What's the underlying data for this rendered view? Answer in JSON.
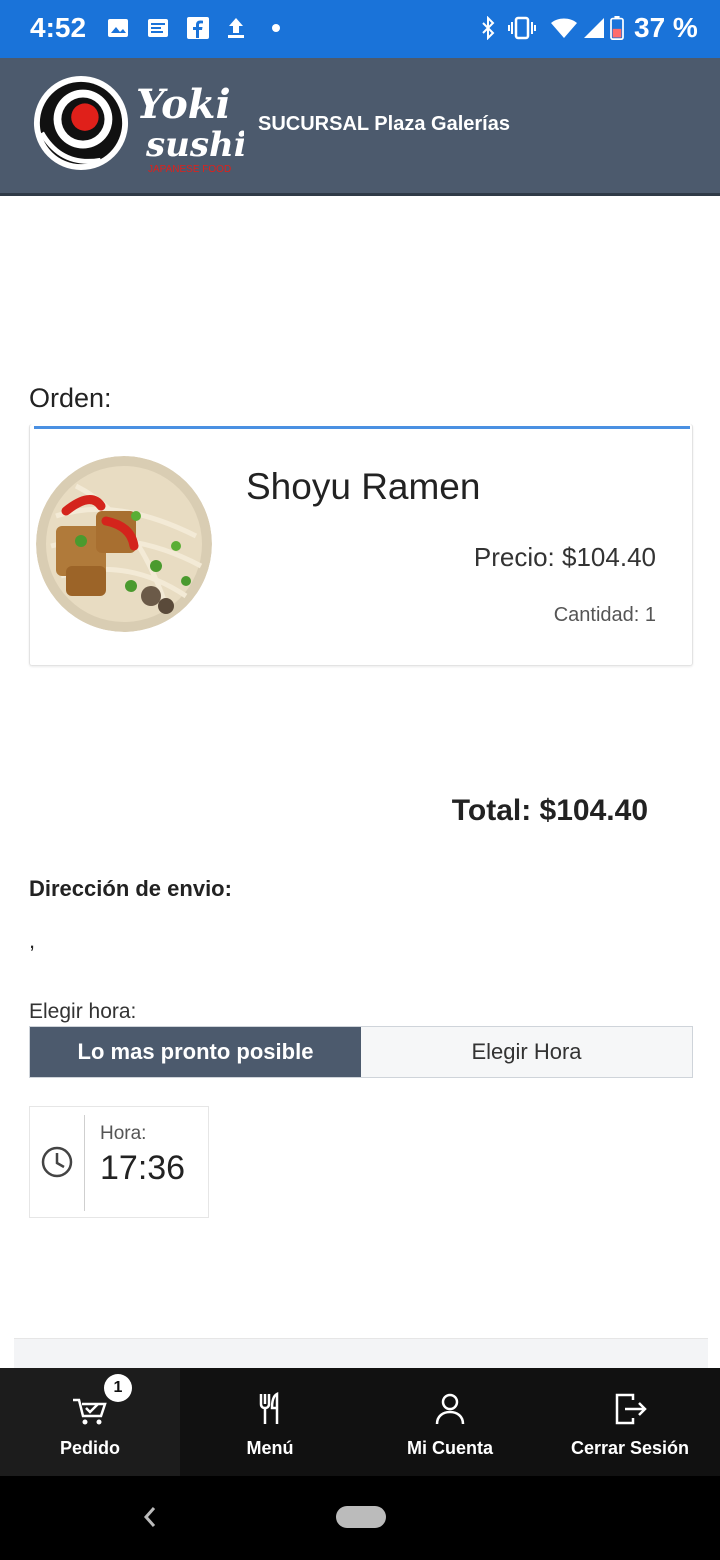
{
  "status_bar": {
    "time": "4:52",
    "battery": "37 %"
  },
  "header": {
    "brand_line1": "Yoki",
    "brand_line2": "sushi",
    "brand_tagline": "JAPANESE FOOD",
    "branch": "SUCURSAL Plaza Galerías"
  },
  "order": {
    "label": "Orden:",
    "items": [
      {
        "name": "Shoyu Ramen",
        "price": "Precio: $104.40",
        "quantity": "Cantidad: 1"
      }
    ],
    "total": "Total: $104.40"
  },
  "shipping": {
    "label": "Dirección de envio:",
    "value": ","
  },
  "schedule": {
    "label": "Elegir hora:",
    "option_asap": "Lo mas pronto posible",
    "option_choose": "Elegir Hora",
    "selected": "Lo mas pronto posible",
    "time_caption": "Hora:",
    "time_value": "17:36"
  },
  "tabbar": {
    "cart_badge": "1",
    "tabs": [
      {
        "label": "Pedido",
        "icon": "cart-icon"
      },
      {
        "label": "Menú",
        "icon": "utensils-icon"
      },
      {
        "label": "Mi Cuenta",
        "icon": "user-icon"
      },
      {
        "label": "Cerrar Sesión",
        "icon": "logout-icon"
      }
    ]
  },
  "colors": {
    "status_bar": "#1a73d9",
    "header": "#4c5a6d",
    "accent_line": "#4a90e2",
    "tabbar": "#111111"
  }
}
